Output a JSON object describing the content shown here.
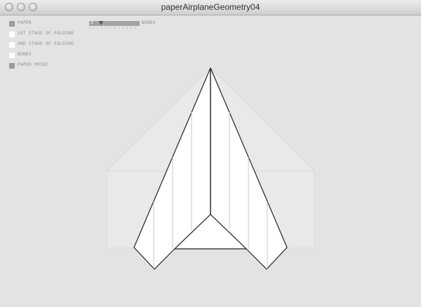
{
  "window": {
    "title": "paperAirplaneGeometry04"
  },
  "controls": {
    "checkboxes": [
      {
        "label": "PAPER",
        "checked": true
      },
      {
        "label": "1ST STAGE OF FOLDING",
        "checked": false
      },
      {
        "label": "2ND STAGE OF FOLDING",
        "checked": false
      },
      {
        "label": "BENDS",
        "checked": false
      },
      {
        "label": "PAPER PRINT",
        "checked": true
      }
    ],
    "bends_slider": {
      "label": "BENDS",
      "value": "3"
    }
  },
  "colors": {
    "background": "#e3e3e3",
    "paper_fill": "#e9e9e9",
    "paper_stroke": "#d8d8d8",
    "plane_fill": "#ffffff",
    "plane_stroke": "#222222",
    "bend_line": "#c8c8c8"
  }
}
